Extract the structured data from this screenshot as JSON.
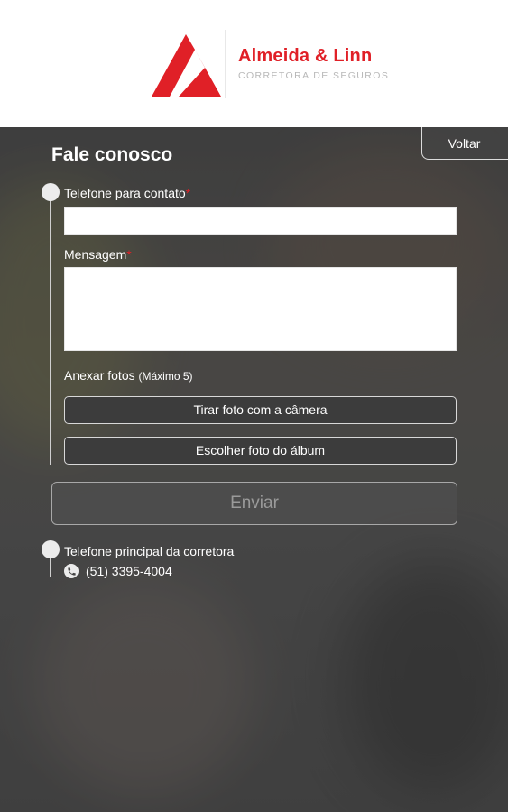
{
  "brand": {
    "name": "Almeida & Linn",
    "subtitle": "CORRETORA DE SEGUROS",
    "accent_color": "#e02027",
    "logo_icon": "triangle-a-logo-icon"
  },
  "nav": {
    "back_label": "Voltar"
  },
  "form": {
    "title": "Fale conosco",
    "phone_label": "Telefone para contato",
    "phone_value": "",
    "message_label": "Mensagem",
    "message_value": "",
    "required_mark": "*",
    "attach_label": "Anexar fotos",
    "attach_note": "(Máximo 5)",
    "camera_button": "Tirar foto com a câmera",
    "album_button": "Escolher foto do álbum",
    "send_button": "Enviar"
  },
  "contact": {
    "label": "Telefone principal da corretora",
    "phone": "(51) 3395-4004",
    "icon": "phone-icon"
  }
}
